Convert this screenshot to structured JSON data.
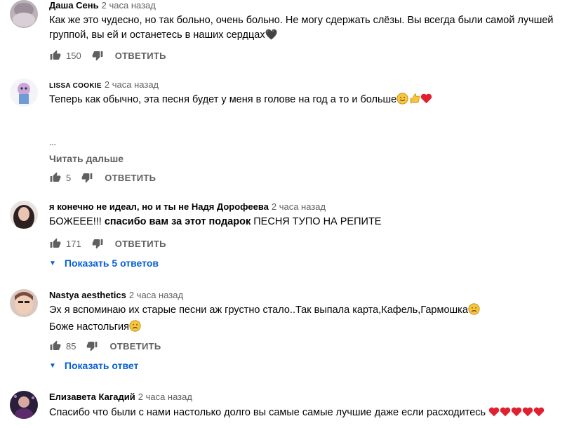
{
  "comments": [
    {
      "author": "Даша Сень",
      "time": "2 часа назад",
      "text1": "Как же это чудесно, но так больно, очень больно. Не могу сдержать слёзы. Вы всегда были самой лучшей",
      "text2": "группой, вы ей и останетесь в наших сердцах",
      "text2_suffix": "🖤",
      "likes": "150",
      "reply": "ОТВЕТИТЬ"
    },
    {
      "author": "LISSA COOKIE",
      "time": "2 часа назад",
      "text1": "Теперь как обычно, эта песня будет у меня в голове на год а то и больше",
      "ellipsis": "...",
      "read_more": "Читать дальше",
      "likes": "5",
      "reply": "ОТВЕТИТЬ"
    },
    {
      "author": "я конечно не идеал, но и ты не Надя Дорофеева",
      "time": "2 часа назад",
      "text_a": "БОЖЕЕЕ!!!",
      "text_b": "спасибо вам за этот подарок",
      "text_c": "ПЕСНЯ ТУПО НА РЕПИТЕ",
      "likes": "171",
      "reply": "ОТВЕТИТЬ",
      "show_replies": "Показать 5 ответов"
    },
    {
      "author": "Nastya aesthetics",
      "time": "2 часа назад",
      "text1": "Эх я вспоминаю их старые песни аж грустно стало..Так выпала карта,Кафель,Гармошка",
      "text2": "Боже настольгия",
      "likes": "85",
      "reply": "ОТВЕТИТЬ",
      "show_replies": "Показать ответ"
    },
    {
      "author": "Елизавета Кагадий",
      "time": "2 часа назад",
      "text1": "Спасибо что были с нами настолько долго вы самые самые лучшие даже если расходитесь"
    }
  ],
  "colors": {
    "link_blue": "#065fd4",
    "meta_gray": "#606060",
    "heart_red": "#e0202e"
  },
  "icons": [
    "thumb-up-icon",
    "thumb-down-icon",
    "chevron-down-icon",
    "heart-icon",
    "thumbs-up-emoji-icon",
    "smile-emoji-icon"
  ]
}
